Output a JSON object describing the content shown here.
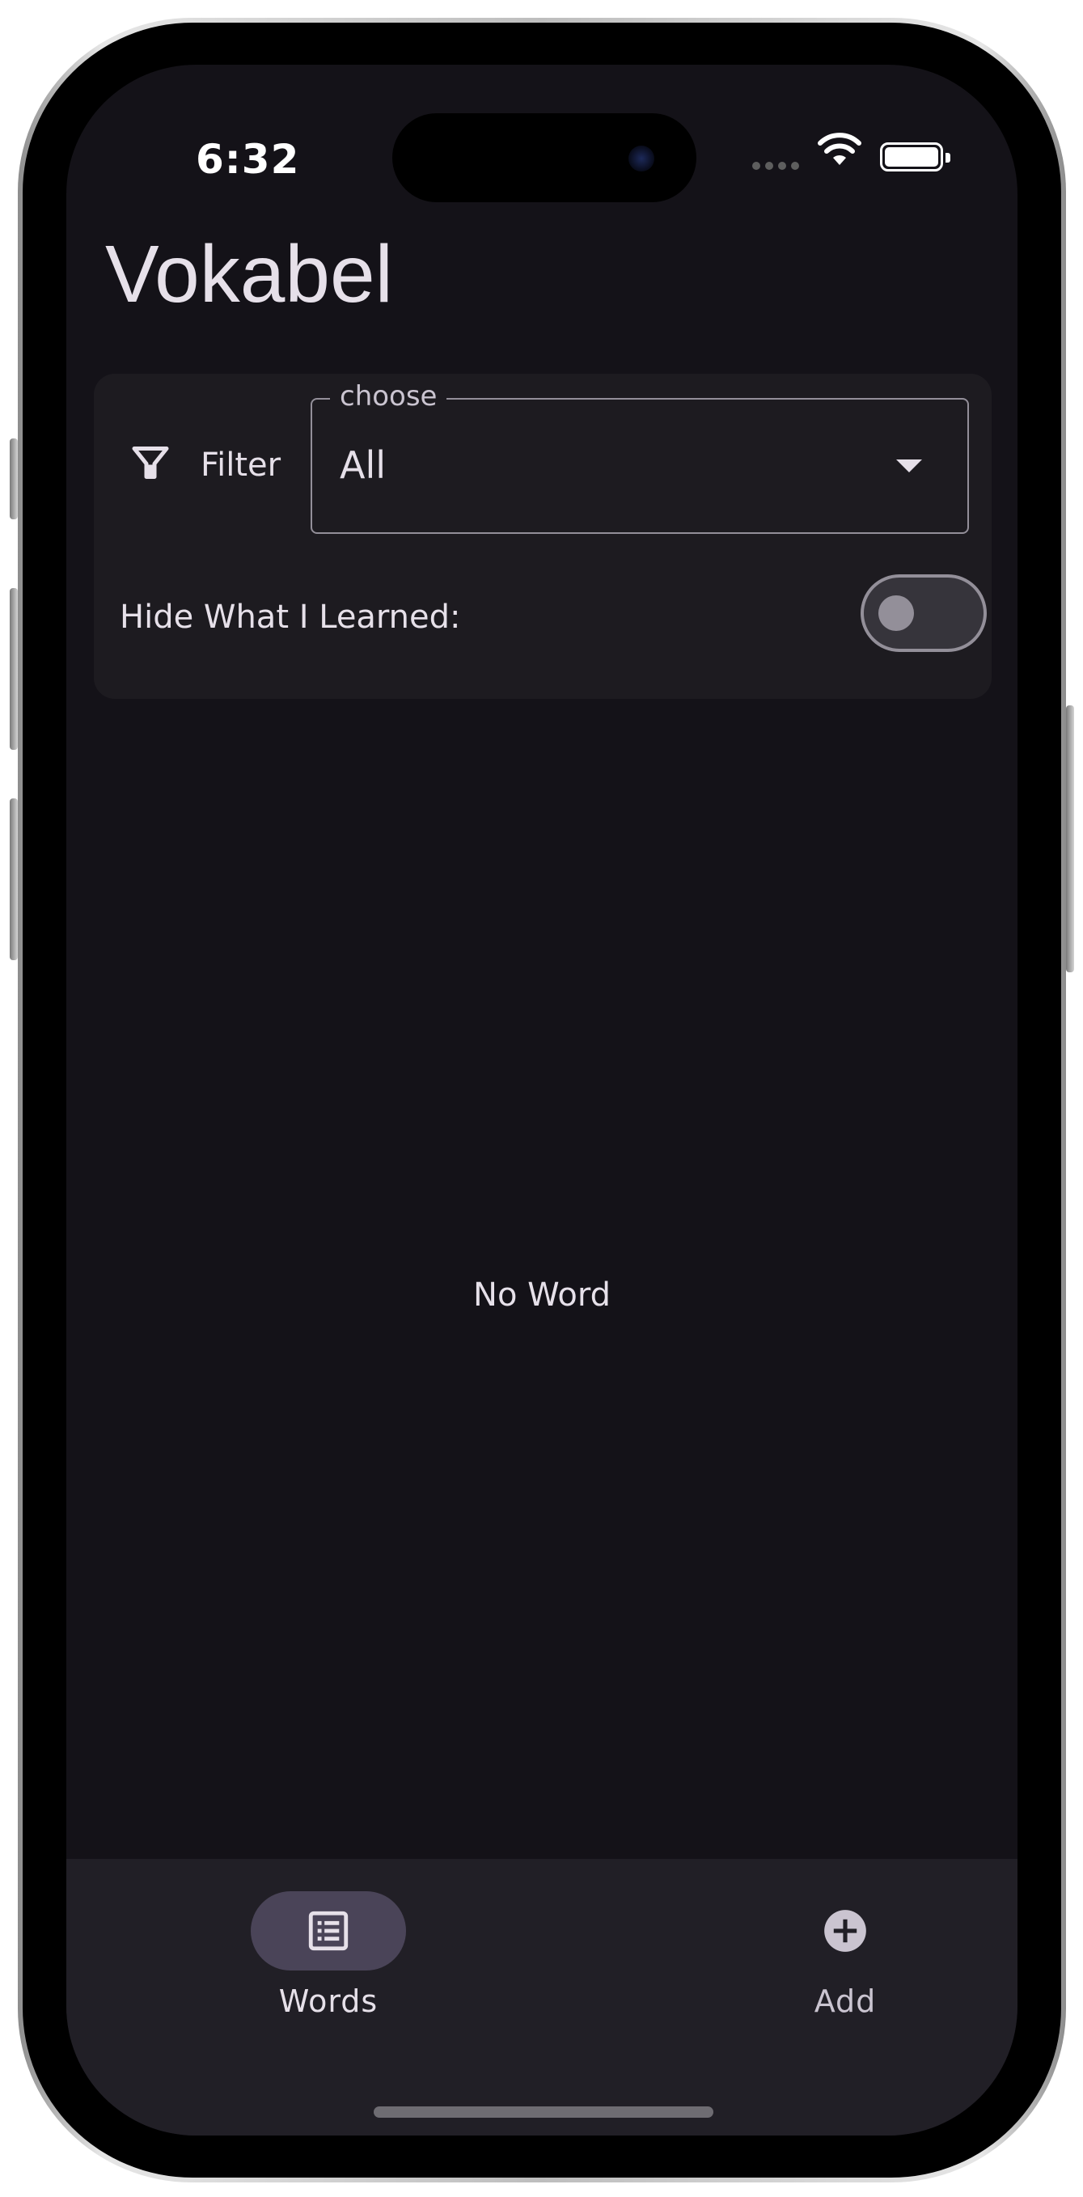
{
  "status_bar": {
    "time": "6:32"
  },
  "app": {
    "title": "Vokabel"
  },
  "filter": {
    "label": "Filter",
    "dropdown": {
      "legend": "choose",
      "selected": "All"
    },
    "hide_learned": {
      "label": "Hide What I Learned:",
      "enabled": false
    }
  },
  "content": {
    "empty_text": "No Word"
  },
  "bottom_nav": {
    "items": [
      {
        "label": "Words",
        "icon": "list-icon",
        "selected": true
      },
      {
        "label": "Add",
        "icon": "add-circle-icon",
        "selected": false
      }
    ]
  },
  "colors": {
    "background": "#141218",
    "surface": "#1d1b20",
    "nav_background": "#211f26",
    "nav_indicator": "#4a4458",
    "outline": "#938f99",
    "on_surface": "#e6e0e9"
  }
}
